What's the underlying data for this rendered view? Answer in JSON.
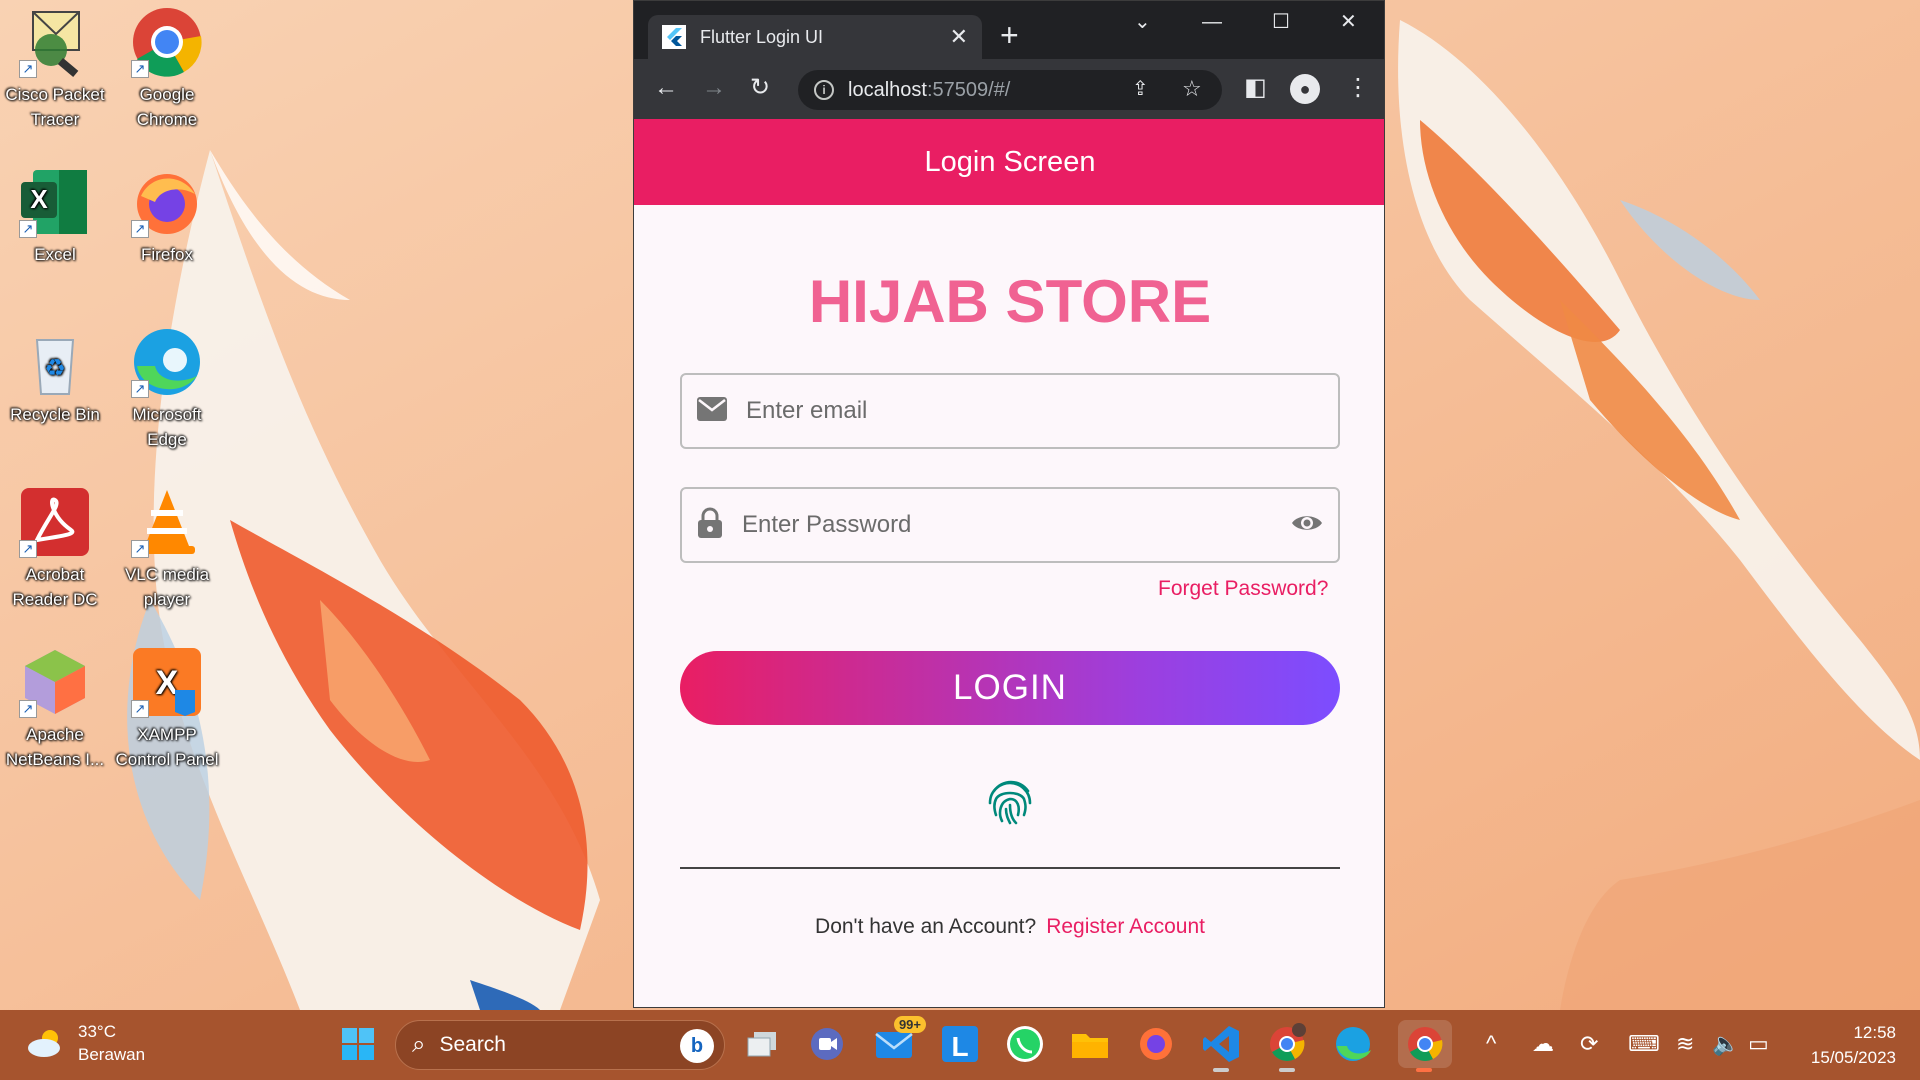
{
  "desktop": {
    "icons": [
      {
        "label": "Cisco Packet Tracer",
        "icon": "cisco-packet-tracer-icon"
      },
      {
        "label": "Google Chrome",
        "icon": "chrome-icon"
      },
      {
        "label": "Excel",
        "icon": "excel-icon"
      },
      {
        "label": "Firefox",
        "icon": "firefox-icon"
      },
      {
        "label": "Recycle Bin",
        "icon": "recycle-bin-icon"
      },
      {
        "label": "Microsoft Edge",
        "icon": "edge-icon"
      },
      {
        "label": "Acrobat Reader DC",
        "icon": "acrobat-icon"
      },
      {
        "label": "VLC media player",
        "icon": "vlc-icon"
      },
      {
        "label": "Apache NetBeans I...",
        "icon": "netbeans-icon"
      },
      {
        "label": "XAMPP Control Panel",
        "icon": "xampp-icon"
      }
    ]
  },
  "browser": {
    "tab_title": "Flutter Login UI",
    "url_host": "localhost",
    "url_path": ":57509/#/"
  },
  "app": {
    "appbar_title": "Login Screen",
    "store_title": "HIJAB STORE",
    "email_placeholder": "Enter email",
    "password_placeholder": "Enter Password",
    "forget_password": "Forget Password?",
    "login_label": "LOGIN",
    "no_account_text": "Don't have an Account?",
    "register_link": "Register Account"
  },
  "taskbar": {
    "weather_temp": "33°C",
    "weather_condition": "Berawan",
    "search_label": "Search",
    "mail_badge": "99+",
    "time": "12:58",
    "date": "15/05/2023"
  },
  "colors": {
    "primary_pink": "#e91e63",
    "title_pink": "#f06292",
    "button_gradient_end": "#7c4dff",
    "fingerprint_teal": "#00897b",
    "taskbar": "#a6542e"
  }
}
